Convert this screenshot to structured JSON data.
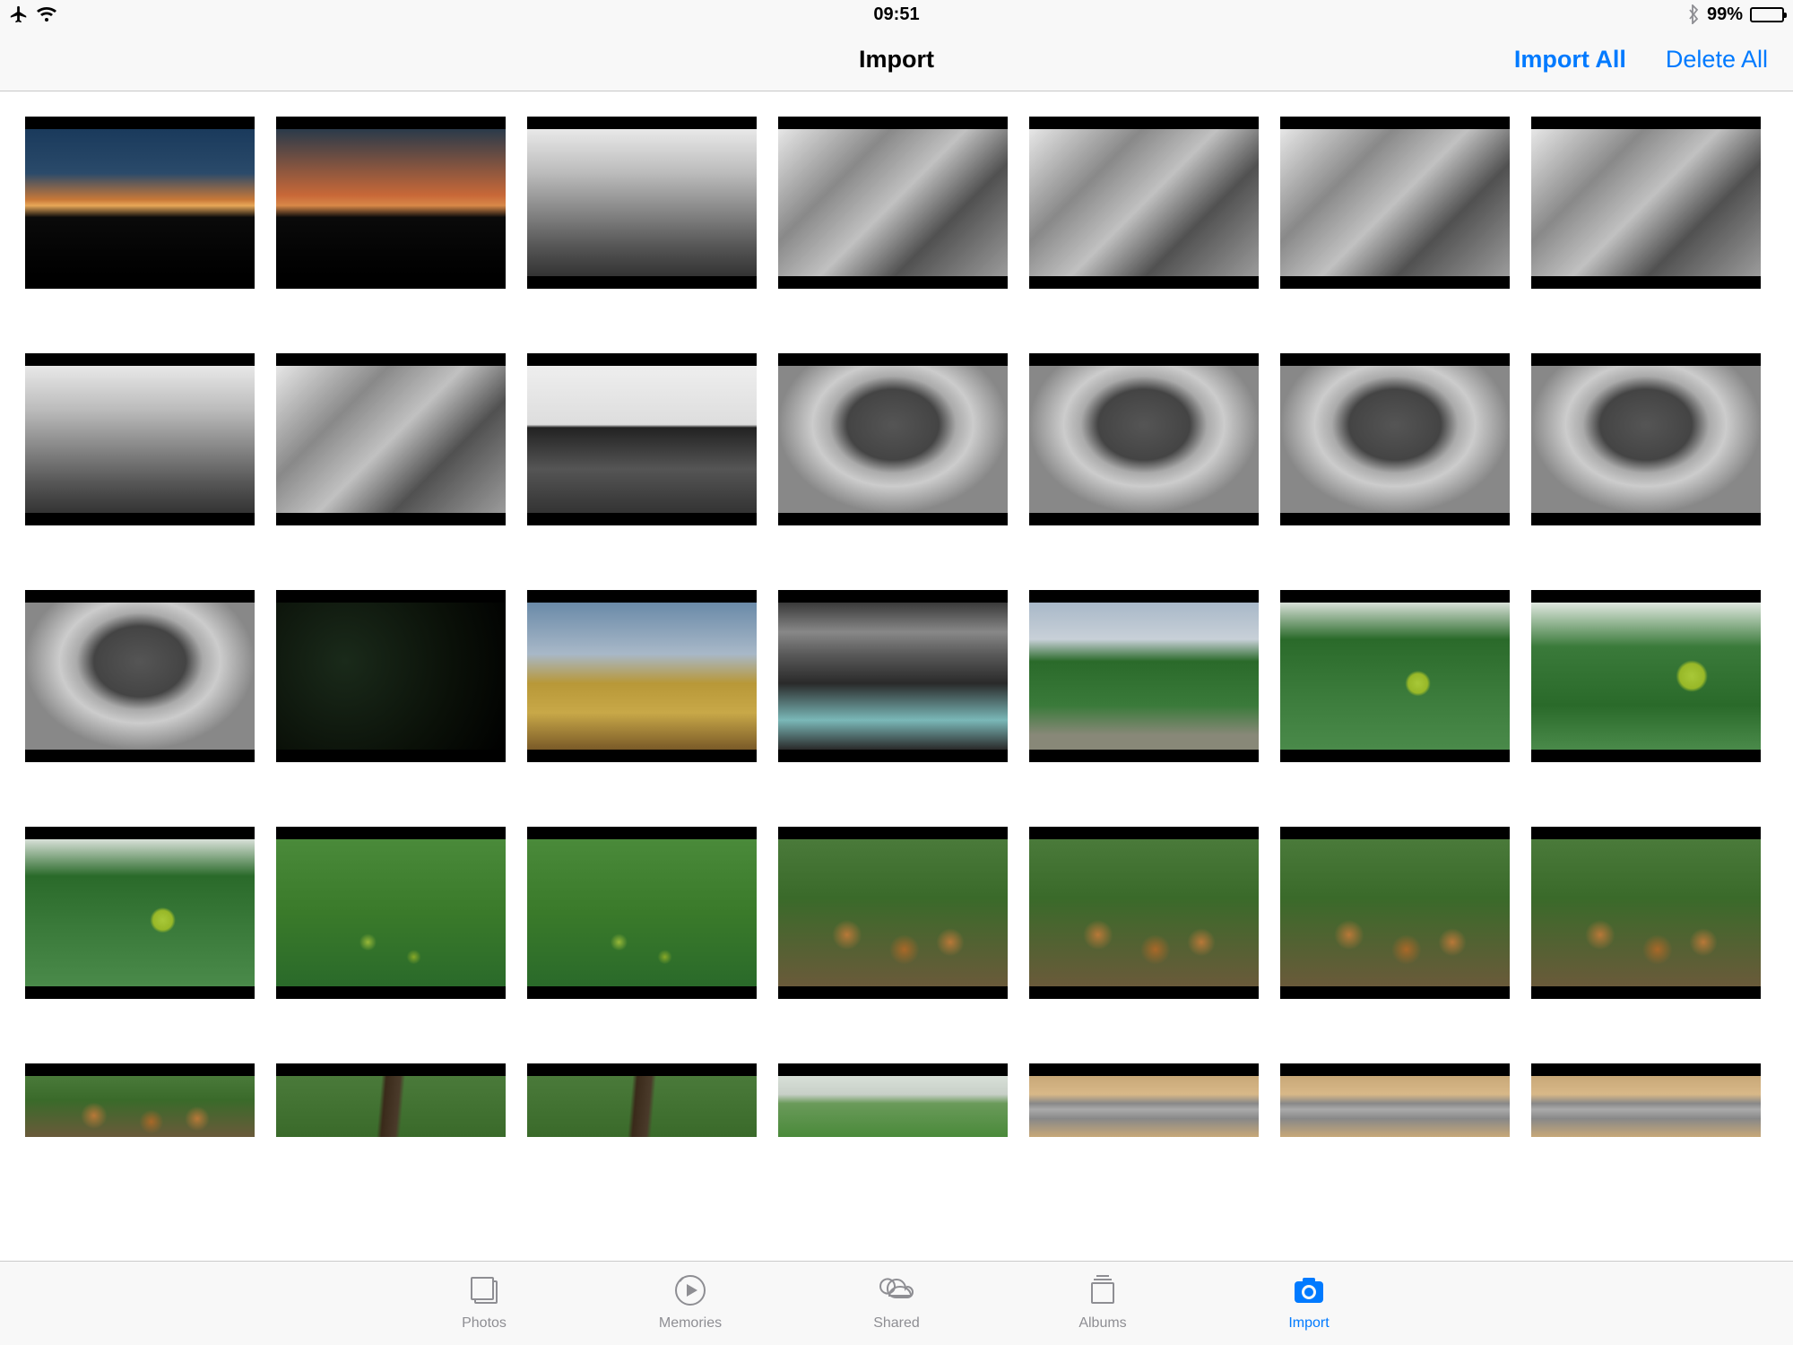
{
  "status": {
    "time": "09:51",
    "battery_pct": "99%",
    "icons": {
      "airplane": "airplane-mode-icon",
      "wifi": "wifi-icon",
      "bluetooth": "bluetooth-icon",
      "battery": "battery-icon"
    }
  },
  "nav": {
    "title": "Import",
    "import_all": "Import All",
    "delete_all": "Delete All"
  },
  "grid": {
    "thumbs": [
      {
        "name": "sunset-a",
        "cls": "sunset1"
      },
      {
        "name": "sunset-b",
        "cls": "sunset2"
      },
      {
        "name": "bw-street-a",
        "cls": "bw-people"
      },
      {
        "name": "bw-street-b",
        "cls": "bw-street"
      },
      {
        "name": "bw-street-c",
        "cls": "bw-street"
      },
      {
        "name": "bw-street-d",
        "cls": "bw-street"
      },
      {
        "name": "bw-street-e",
        "cls": "bw-street"
      },
      {
        "name": "bw-street-f",
        "cls": "bw-people"
      },
      {
        "name": "bw-street-g",
        "cls": "bw-street"
      },
      {
        "name": "bw-silhouette",
        "cls": "bw-sil"
      },
      {
        "name": "bw-tree-a",
        "cls": "bw-tree"
      },
      {
        "name": "bw-tree-b",
        "cls": "bw-tree"
      },
      {
        "name": "bw-tree-c",
        "cls": "bw-tree"
      },
      {
        "name": "bw-tree-d",
        "cls": "bw-tree"
      },
      {
        "name": "bw-tree-e",
        "cls": "bw-tree"
      },
      {
        "name": "dark-forest",
        "cls": "dark"
      },
      {
        "name": "golden-field",
        "cls": "field"
      },
      {
        "name": "car-interior",
        "cls": "car"
      },
      {
        "name": "garden-path",
        "cls": "garden"
      },
      {
        "name": "apple-tree-a",
        "cls": "apples-tree"
      },
      {
        "name": "apple-tree-b",
        "cls": "apples-tree2"
      },
      {
        "name": "apple-tree-c",
        "cls": "apples-tree"
      },
      {
        "name": "grass-apples-a",
        "cls": "grass-green"
      },
      {
        "name": "grass-apples-b",
        "cls": "grass-green"
      },
      {
        "name": "grass-apples-c",
        "cls": "grass-brown"
      },
      {
        "name": "grass-apples-d",
        "cls": "grass-brown"
      },
      {
        "name": "grass-apples-e",
        "cls": "grass-brown"
      },
      {
        "name": "grass-apples-f",
        "cls": "grass-brown"
      },
      {
        "name": "grass-apples-g",
        "cls": "grass-brown",
        "partial": true
      },
      {
        "name": "branch-a",
        "cls": "branch",
        "partial": true
      },
      {
        "name": "branch-b",
        "cls": "branch",
        "partial": true
      },
      {
        "name": "lawn",
        "cls": "lawn",
        "partial": true
      },
      {
        "name": "package-a",
        "cls": "package",
        "partial": true
      },
      {
        "name": "package-b",
        "cls": "package",
        "partial": true
      },
      {
        "name": "package-c",
        "cls": "package",
        "partial": true
      }
    ]
  },
  "tabs": {
    "photos": "Photos",
    "memories": "Memories",
    "shared": "Shared",
    "albums": "Albums",
    "import": "Import",
    "active": "import"
  }
}
